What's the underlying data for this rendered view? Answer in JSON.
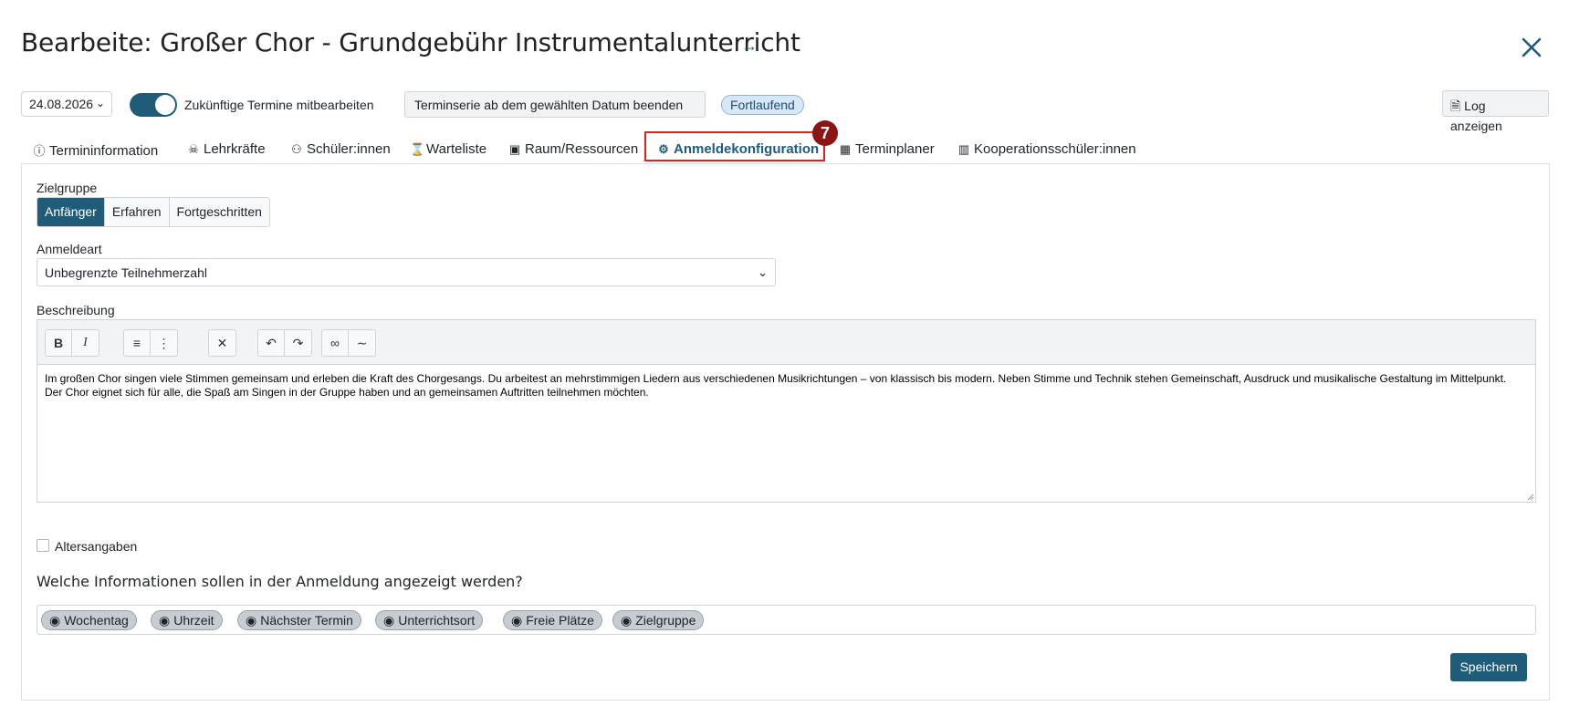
{
  "header": {
    "title": "Bearbeite: Großer Chor - Grundgebühr Instrumentalunterricht"
  },
  "toolbar": {
    "date_value": "24.08.2026",
    "toggle_label": "Zukünftige Termine mitbearbeiten",
    "toggle_on": true,
    "end_series_label": "Terminserie ab dem gewählten Datum beenden",
    "status_badge": "Fortlaufend",
    "log_label": "Log anzeigen"
  },
  "tabs": [
    {
      "label": "Termininformation",
      "icon": "info-circle-icon"
    },
    {
      "label": "Lehrkräfte",
      "icon": "teacher-icon"
    },
    {
      "label": "Schüler:innen",
      "icon": "student-icon"
    },
    {
      "label": "Warteliste",
      "icon": "hourglass-icon"
    },
    {
      "label": "Raum/Ressourcen",
      "icon": "briefcase-icon"
    },
    {
      "label": "Anmeldekonfiguration",
      "icon": "graduation-cap-gear-icon",
      "active": true
    },
    {
      "label": "Terminplaner",
      "icon": "calendar-table-icon"
    },
    {
      "label": "Kooperationsschüler:innen",
      "icon": "bar-chart-icon"
    }
  ],
  "annotation": {
    "step_number": "7",
    "color": "#8b1414",
    "highlight_color": "#e1221c"
  },
  "form": {
    "target_group_label": "Zielgruppe",
    "target_group_options": [
      "Anfänger",
      "Erfahren",
      "Fortgeschritten"
    ],
    "target_group_selected": "Anfänger",
    "registration_type_label": "Anmeldeart",
    "registration_type_value": "Unbegrenzte Teilnehmerzahl",
    "description_label": "Beschreibung",
    "description_text": "Im großen Chor singen viele Stimmen gemeinsam und erleben die Kraft des Chorgesangs. Du arbeitest an mehrstimmigen Liedern aus verschiedenen Musikrichtungen – von klassisch bis modern. Neben Stimme und Technik stehen Gemeinschaft, Ausdruck und musikalische Gestaltung im Mittelpunkt. Der Chor eignet sich für alle, die Spaß am Singen in der Gruppe haben und an gemeinsamen Auftritten teilnehmen möchten.",
    "editor_buttons": {
      "bold": "B",
      "italic": "I"
    },
    "age_checkbox_label": "Altersangaben",
    "age_checkbox_checked": false,
    "info_heading": "Welche Informationen sollen in der Anmeldung angezeigt werden?",
    "info_chips": [
      "Wochentag",
      "Uhrzeit",
      "Nächster Termin",
      "Unterrichtsort",
      "Freie Plätze",
      "Zielgruppe"
    ],
    "save_label": "Speichern"
  },
  "colors": {
    "primary": "#1e5c7a",
    "chip_bg": "#c6ccd1"
  }
}
